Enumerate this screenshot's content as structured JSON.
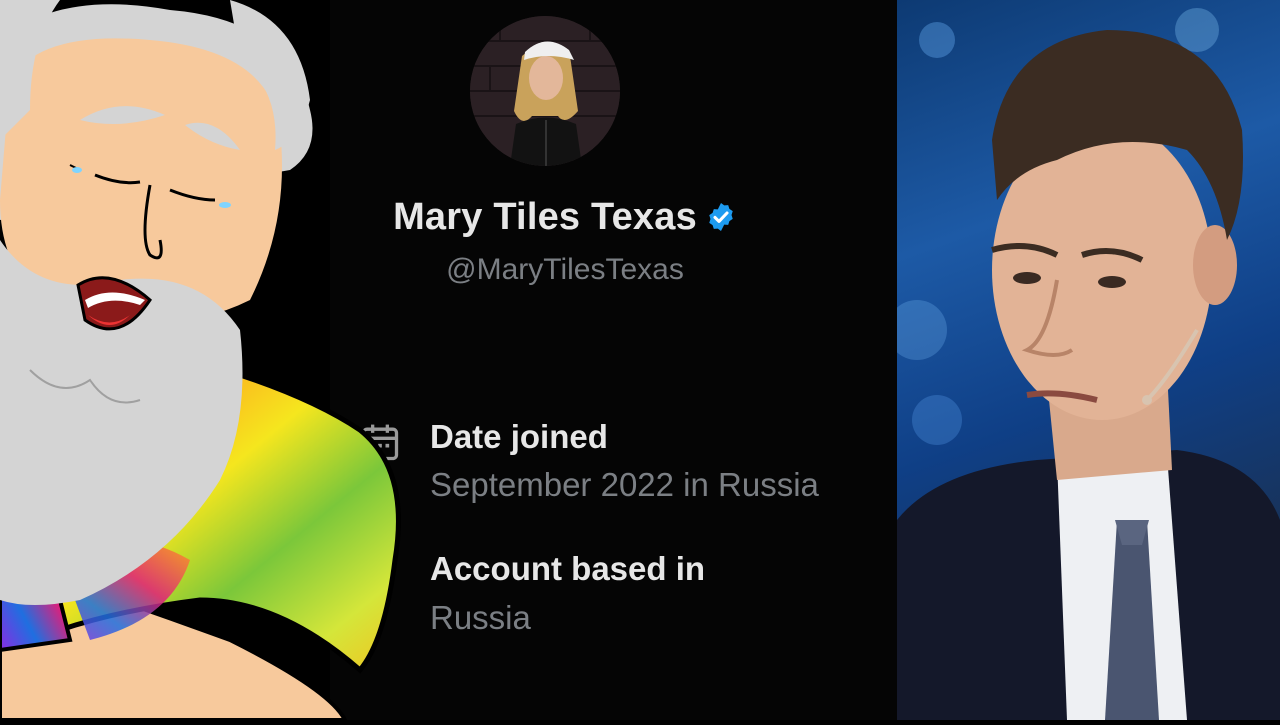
{
  "profile": {
    "display_name": "Mary Tiles Texas",
    "handle": "@MaryTilesTexas",
    "verified": true,
    "date_joined_label": "Date joined",
    "date_joined_value": "September 2022 in Russia",
    "account_based_label": "Account based in",
    "account_based_value": "Russia"
  },
  "icons": {
    "verified": "verified-badge-icon",
    "calendar": "calendar-icon"
  },
  "colors": {
    "background": "#000000",
    "primary_text": "#e7e7e7",
    "secondary_text": "#7b7f84",
    "verified_blue": "#1d9bf0"
  }
}
